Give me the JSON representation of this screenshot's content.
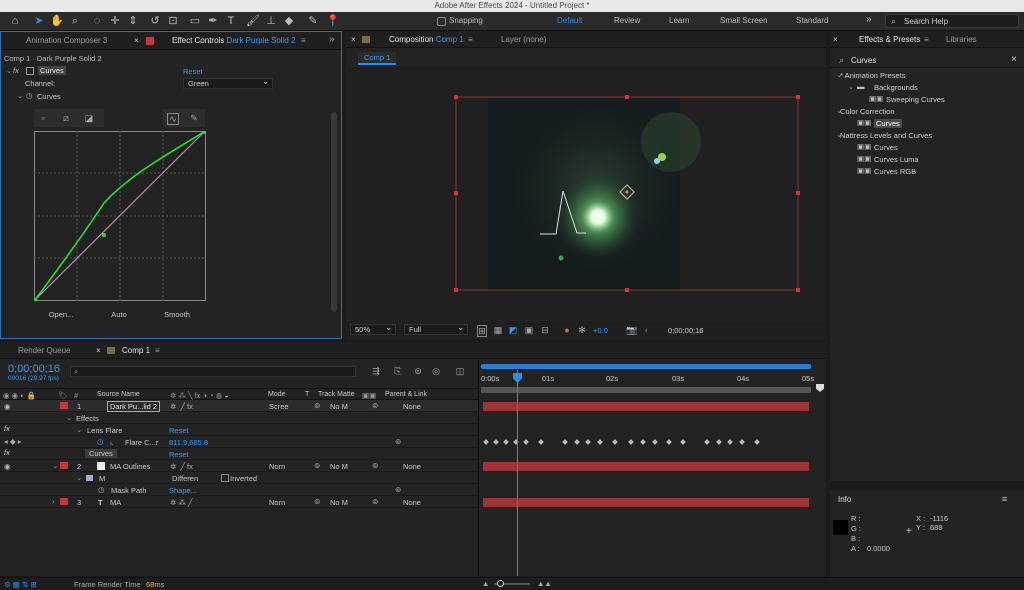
{
  "window_title": "Adobe After Effects 2024 - Untitled Project *",
  "toolbar": {
    "snapping_label": "Snapping",
    "workspaces": [
      "Default",
      "Review",
      "Learn",
      "Small Screen",
      "Standard"
    ],
    "active_workspace": "Default",
    "search_placeholder": "Search Help"
  },
  "left_panel": {
    "tab_animation_composer": "Animation Composer 3",
    "tab_effect_controls_prefix": "Effect Controls",
    "tab_effect_controls_layer": "Dark Purple Solid 2",
    "breadcrumb": "Comp 1 · Dark Purple Solid 2",
    "effect_name": "Curves",
    "reset_label": "Reset",
    "channel_label": "Channel:",
    "channel_value": "Green",
    "curves_label": "Curves",
    "open_button": "Open...",
    "auto_button": "Auto",
    "smooth_button": "Smooth"
  },
  "comp_panel": {
    "tab_prefix": "Composition",
    "tab_name": "Comp 1",
    "layer_tab": "Layer (none)",
    "crumb": "Comp 1",
    "zoom": "50%",
    "resolution": "Full",
    "exposure": "+0.0",
    "timecode": "0;00;00;16"
  },
  "effects_presets": {
    "tab_effects": "Effects & Presets",
    "tab_libraries": "Libraries",
    "search_value": "Curves",
    "tree": [
      {
        "label": "* Animation Presets",
        "indent": 0,
        "kind": "group"
      },
      {
        "label": "Backgrounds",
        "indent": 1,
        "kind": "folder"
      },
      {
        "label": "Sweeping Curves",
        "indent": 2,
        "kind": "preset"
      },
      {
        "label": "Color Correction",
        "indent": 0,
        "kind": "group"
      },
      {
        "label": "Curves",
        "indent": 1,
        "kind": "effect",
        "selected": true
      },
      {
        "label": "Nattress Levels and Curves",
        "indent": 0,
        "kind": "group"
      },
      {
        "label": "Curves",
        "indent": 1,
        "kind": "effect"
      },
      {
        "label": "Curves Luma",
        "indent": 1,
        "kind": "effect"
      },
      {
        "label": "Curves RGB",
        "indent": 1,
        "kind": "effect"
      }
    ]
  },
  "info_panel": {
    "title": "Info",
    "r_label": "R :",
    "g_label": "G :",
    "b_label": "B :",
    "a_label": "A :",
    "a_value": "0.0000",
    "x_label": "X :",
    "x_value": "-1116",
    "y_label": "Y :",
    "y_value": "688"
  },
  "timeline": {
    "tab_render_queue": "Render Queue",
    "tab_comp": "Comp 1",
    "timecode": "0;00;00;16",
    "frame_info": "00016 (29.97 fps)",
    "col_source_name": "Source Name",
    "col_mode": "Mode",
    "col_t": "T",
    "col_track_matte": "Track Matte",
    "col_parent": "Parent & Link",
    "ruler_labels": [
      "0:00s",
      "01s",
      "02s",
      "03s",
      "04s",
      "05s"
    ],
    "layers": {
      "l1_num": "1",
      "l1_name": "Dark Pu...lid 2",
      "l1_mode": "Scree",
      "l1_matte": "No M",
      "l1_parent": "None",
      "effects_label": "Effects",
      "lens_flare_label": "Lens Flare",
      "lens_flare_reset": "Reset",
      "flare_center_label": "Flare C...r",
      "flare_center_value": "811.9,685.8",
      "curves_label": "Curves",
      "curves_reset": "Reset",
      "l2_num": "2",
      "l2_name": "MA Outlines",
      "l2_mode": "Norn",
      "l2_matte": "No M",
      "l2_parent": "None",
      "mask_label": "M",
      "mask_mode": "Differen",
      "inverted_label": "Inverted",
      "mask_path_label": "Mask Path",
      "mask_path_value": "Shape...",
      "l3_num": "3",
      "l3_type": "T",
      "l3_name": "MA",
      "l3_mode": "Norn",
      "l3_matte": "No M",
      "l3_parent": "None"
    }
  },
  "status": {
    "frame_render_label": "Frame Render Time",
    "frame_render_value": "68ms"
  },
  "colors": {
    "accent": "#2d8ceb",
    "track_red": "#9c3434",
    "curve_green": "#27e12f"
  }
}
